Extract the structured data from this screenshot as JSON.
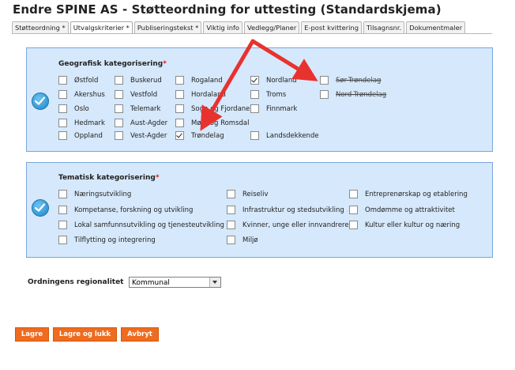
{
  "page_title": "Endre SPINE AS - Støtteordning for uttesting (Standardskjema)",
  "tabs": [
    {
      "label": "Støtteordning *",
      "active": false
    },
    {
      "label": "Utvalgskriterier *",
      "active": true
    },
    {
      "label": "Publiseringstekst *",
      "active": false
    },
    {
      "label": "Viktig info",
      "active": false
    },
    {
      "label": "Vedlegg/Planer",
      "active": false
    },
    {
      "label": "E-post kvittering",
      "active": false
    },
    {
      "label": "Tilsagnsnr.",
      "active": false
    },
    {
      "label": "Dokumentmaler",
      "active": false
    }
  ],
  "geo": {
    "title": "Geografisk kategorisering",
    "required_mark": "*",
    "items": [
      {
        "label": "Østfold",
        "checked": false
      },
      {
        "label": "Akershus",
        "checked": false
      },
      {
        "label": "Oslo",
        "checked": false
      },
      {
        "label": "Hedmark",
        "checked": false
      },
      {
        "label": "Oppland",
        "checked": false
      },
      {
        "label": "Buskerud",
        "checked": false
      },
      {
        "label": "Vestfold",
        "checked": false
      },
      {
        "label": "Telemark",
        "checked": false
      },
      {
        "label": "Aust-Agder",
        "checked": false
      },
      {
        "label": "Vest-Agder",
        "checked": false
      },
      {
        "label": "Rogaland",
        "checked": false
      },
      {
        "label": "Hordaland",
        "checked": false
      },
      {
        "label": "Sogn og Fjordane",
        "checked": false
      },
      {
        "label": "Møre og Romsdal",
        "checked": false
      },
      {
        "label": "Trøndelag",
        "checked": true
      },
      {
        "label": "Nordland",
        "checked": true
      },
      {
        "label": "Troms",
        "checked": false
      },
      {
        "label": "Finnmark",
        "checked": false
      },
      {
        "label": "Landsdekkende",
        "checked": false
      },
      {
        "label": "Sør-Trøndelag",
        "checked": false,
        "struck": true
      },
      {
        "label": "Nord-Trøndelag",
        "checked": false,
        "struck": true
      }
    ]
  },
  "theme": {
    "title": "Tematisk kategorisering",
    "required_mark": "*",
    "items": [
      {
        "label": "Næringsutvikling",
        "checked": false
      },
      {
        "label": "Kompetanse, forskning og utvikling",
        "checked": false
      },
      {
        "label": "Lokal samfunnsutvikling og tjenesteutvikling",
        "checked": false
      },
      {
        "label": "Tilflytting og integrering",
        "checked": false
      },
      {
        "label": "Reiseliv",
        "checked": false
      },
      {
        "label": "Infrastruktur og stedsutvikling",
        "checked": false
      },
      {
        "label": "Kvinner, unge eller innvandrere",
        "checked": false
      },
      {
        "label": "Miljø",
        "checked": false
      },
      {
        "label": "Entreprenørskap og etablering",
        "checked": false
      },
      {
        "label": "Omdømme og attraktivitet",
        "checked": false
      },
      {
        "label": "Kultur eller kultur og næring",
        "checked": false
      }
    ]
  },
  "regional": {
    "label": "Ordningens regionalitet",
    "selected": "Kommunal"
  },
  "buttons": {
    "save": "Lagre",
    "save_close": "Lagre og lukk",
    "cancel": "Avbryt"
  },
  "colors": {
    "panel_bg": "#d6e8fb",
    "button": "#ee6b1f",
    "arrow": "#e8322e",
    "required": "#e0201c"
  },
  "icons": [
    "check-circle-icon",
    "annotation-arrow"
  ]
}
